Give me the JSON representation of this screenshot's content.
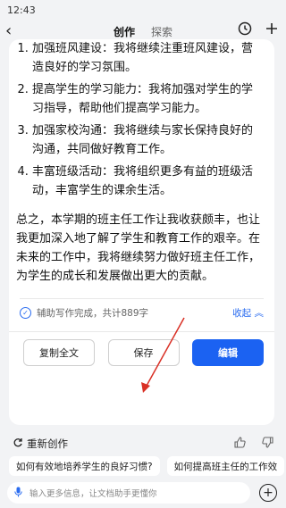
{
  "status_bar": {
    "time": "12:43"
  },
  "header": {
    "tabs": [
      {
        "label": "创作",
        "active": true
      },
      {
        "label": "探索",
        "active": false
      }
    ]
  },
  "article": {
    "items": [
      "加强班风建设：我将继续注重班风建设，营造良好的学习氛围。",
      "提高学生的学习能力：我将加强对学生的学习指导，帮助他们提高学习能力。",
      "加强家校沟通：我将继续与家长保持良好的沟通，共同做好教育工作。",
      "丰富班级活动：我将组织更多有益的班级活动，丰富学生的课余生活。"
    ],
    "summary": "总之，本学期的班主任工作让我收获颇丰，也让我更加深入地了解了学生和教育工作的艰辛。在未来的工作中，我将继续努力做好班主任工作，为学生的成长和发展做出更大的贡献。"
  },
  "assist": {
    "status_text": "辅助写作完成，共计889字",
    "collapse_label": "收起"
  },
  "actions": {
    "copy_label": "复制全文",
    "save_label": "保存",
    "edit_label": "编辑"
  },
  "recreate": {
    "label": "重新创作"
  },
  "suggestions": [
    "如何有效地培养学生的良好习惯?",
    "如何提高班主任的工作效"
  ],
  "input": {
    "placeholder": "输入更多信息，让文档助手更懂你"
  },
  "colors": {
    "accent": "#1b62f2",
    "annotation_arrow": "#d93025"
  }
}
